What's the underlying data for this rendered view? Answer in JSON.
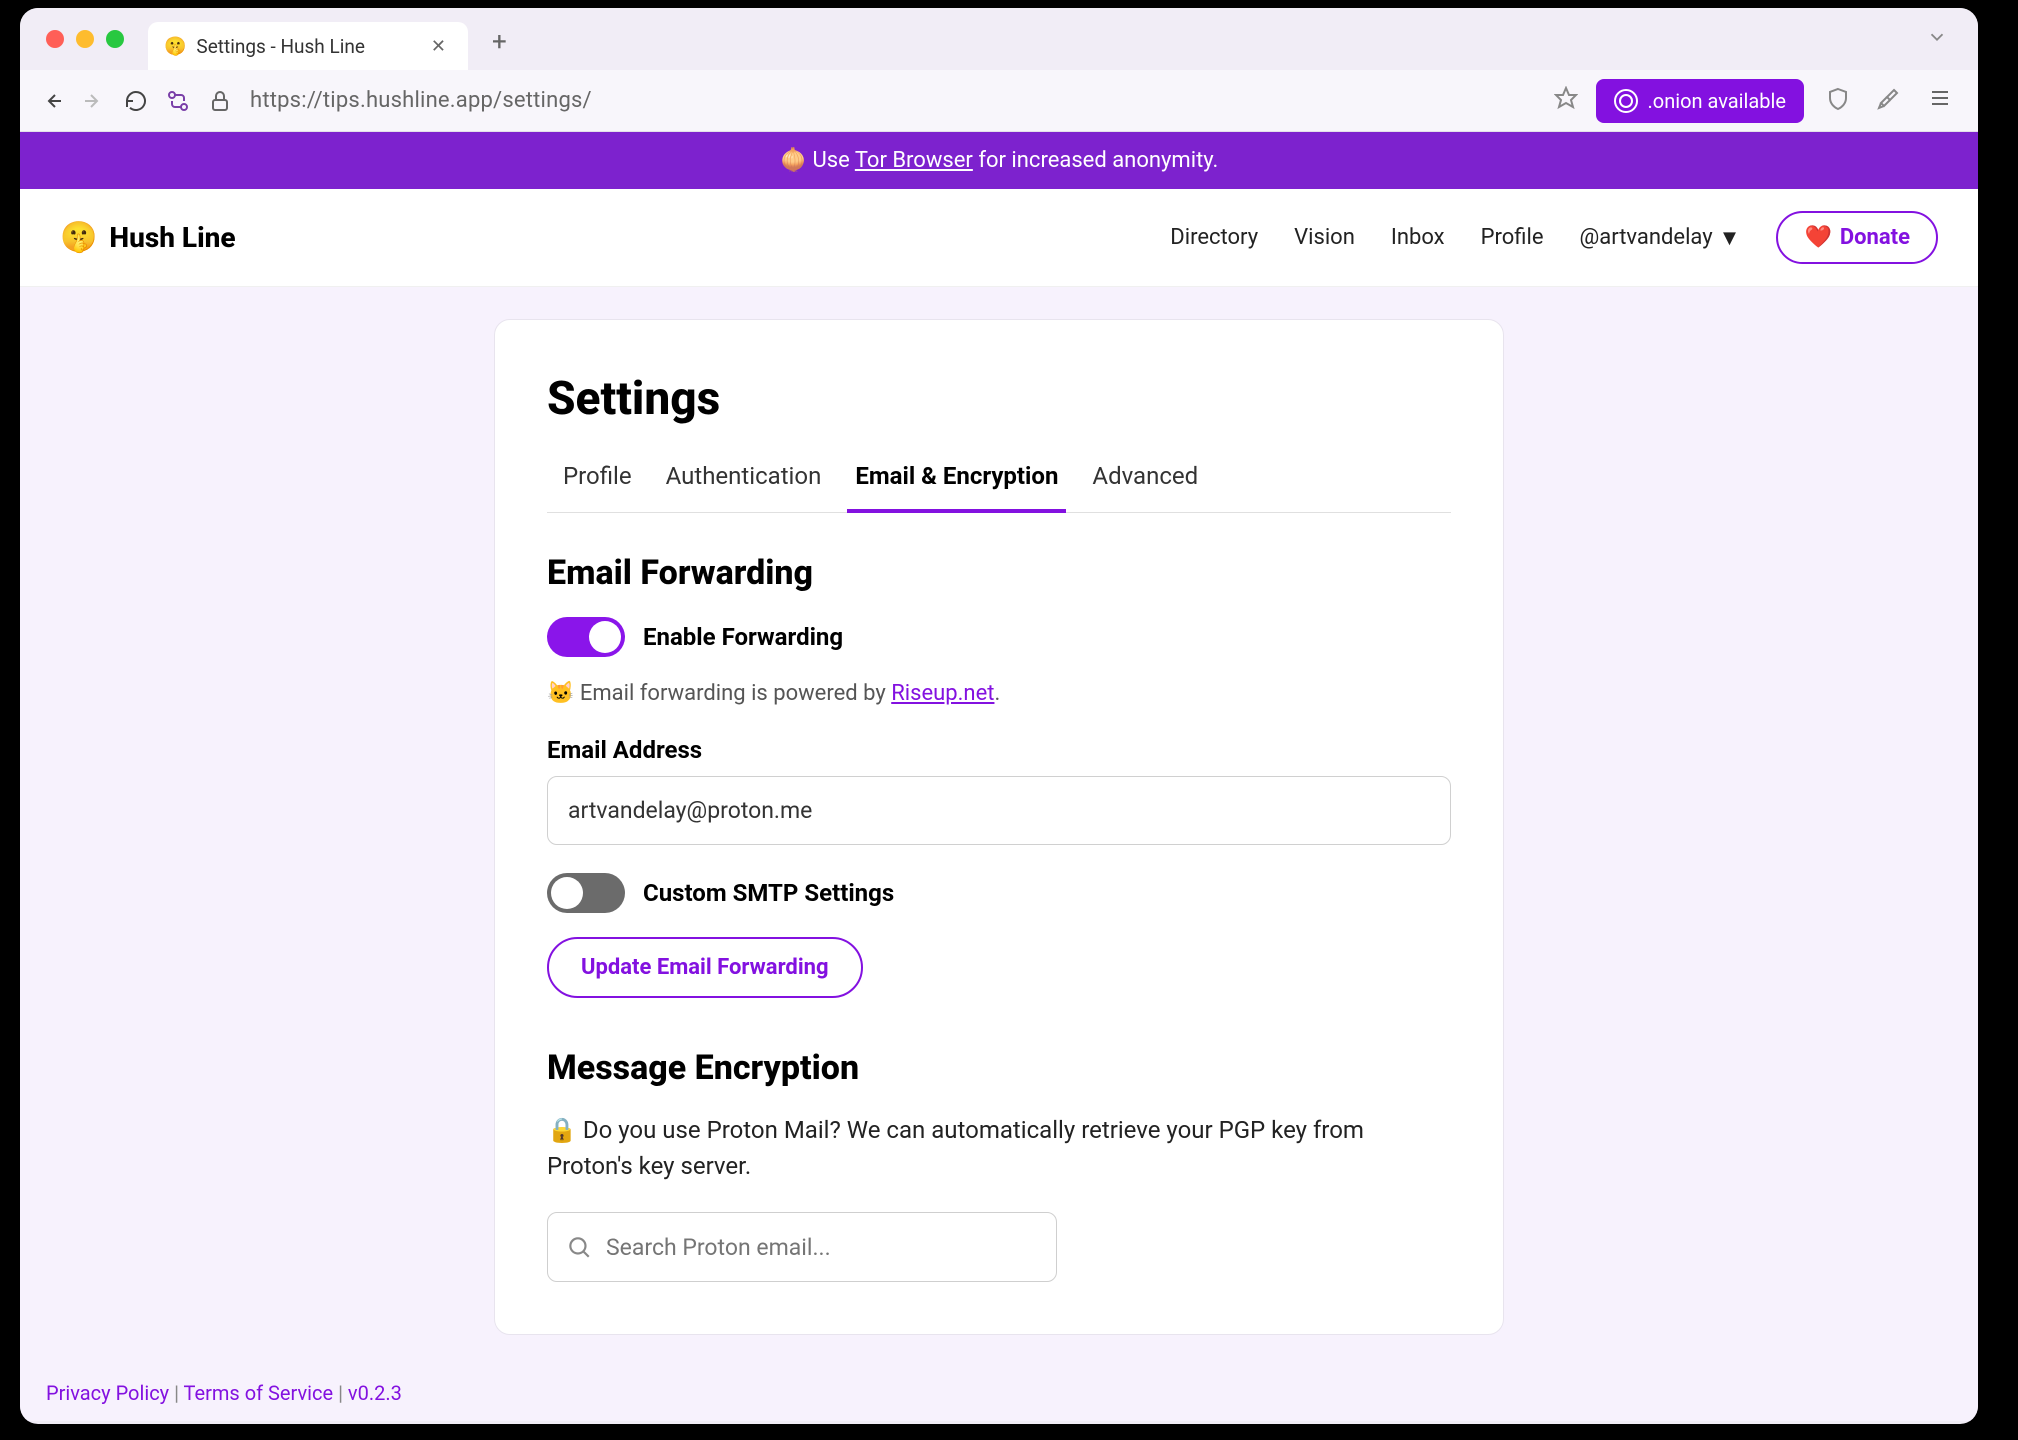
{
  "browser": {
    "tab_title": "Settings - Hush Line",
    "url": "https://tips.hushline.app/settings/",
    "onion_label": ".onion available"
  },
  "banner": {
    "emoji": "🧅",
    "prefix": " Use ",
    "link": "Tor Browser",
    "suffix": " for increased anonymity."
  },
  "header": {
    "logo_text": "Hush Line",
    "nav": [
      "Directory",
      "Vision",
      "Inbox",
      "Profile"
    ],
    "user": "@artvandelay",
    "donate": "Donate"
  },
  "settings": {
    "title": "Settings",
    "tabs": [
      "Profile",
      "Authentication",
      "Email & Encryption",
      "Advanced"
    ],
    "active_tab": 2,
    "forwarding": {
      "title": "Email Forwarding",
      "enable_label": "Enable Forwarding",
      "poweredby_prefix": "🐱 Email forwarding is powered by ",
      "poweredby_link": "Riseup.net",
      "poweredby_suffix": ".",
      "email_label": "Email Address",
      "email_value": "artvandelay@proton.me",
      "smtp_label": "Custom SMTP Settings",
      "update_btn": "Update Email Forwarding"
    },
    "encryption": {
      "title": "Message Encryption",
      "description": "🔒 Do you use Proton Mail? We can automatically retrieve your PGP key from Proton's key server.",
      "search_placeholder": "Search Proton email..."
    }
  },
  "footer": {
    "privacy": "Privacy Policy",
    "terms": "Terms of Service",
    "version": "v0.2.3"
  }
}
